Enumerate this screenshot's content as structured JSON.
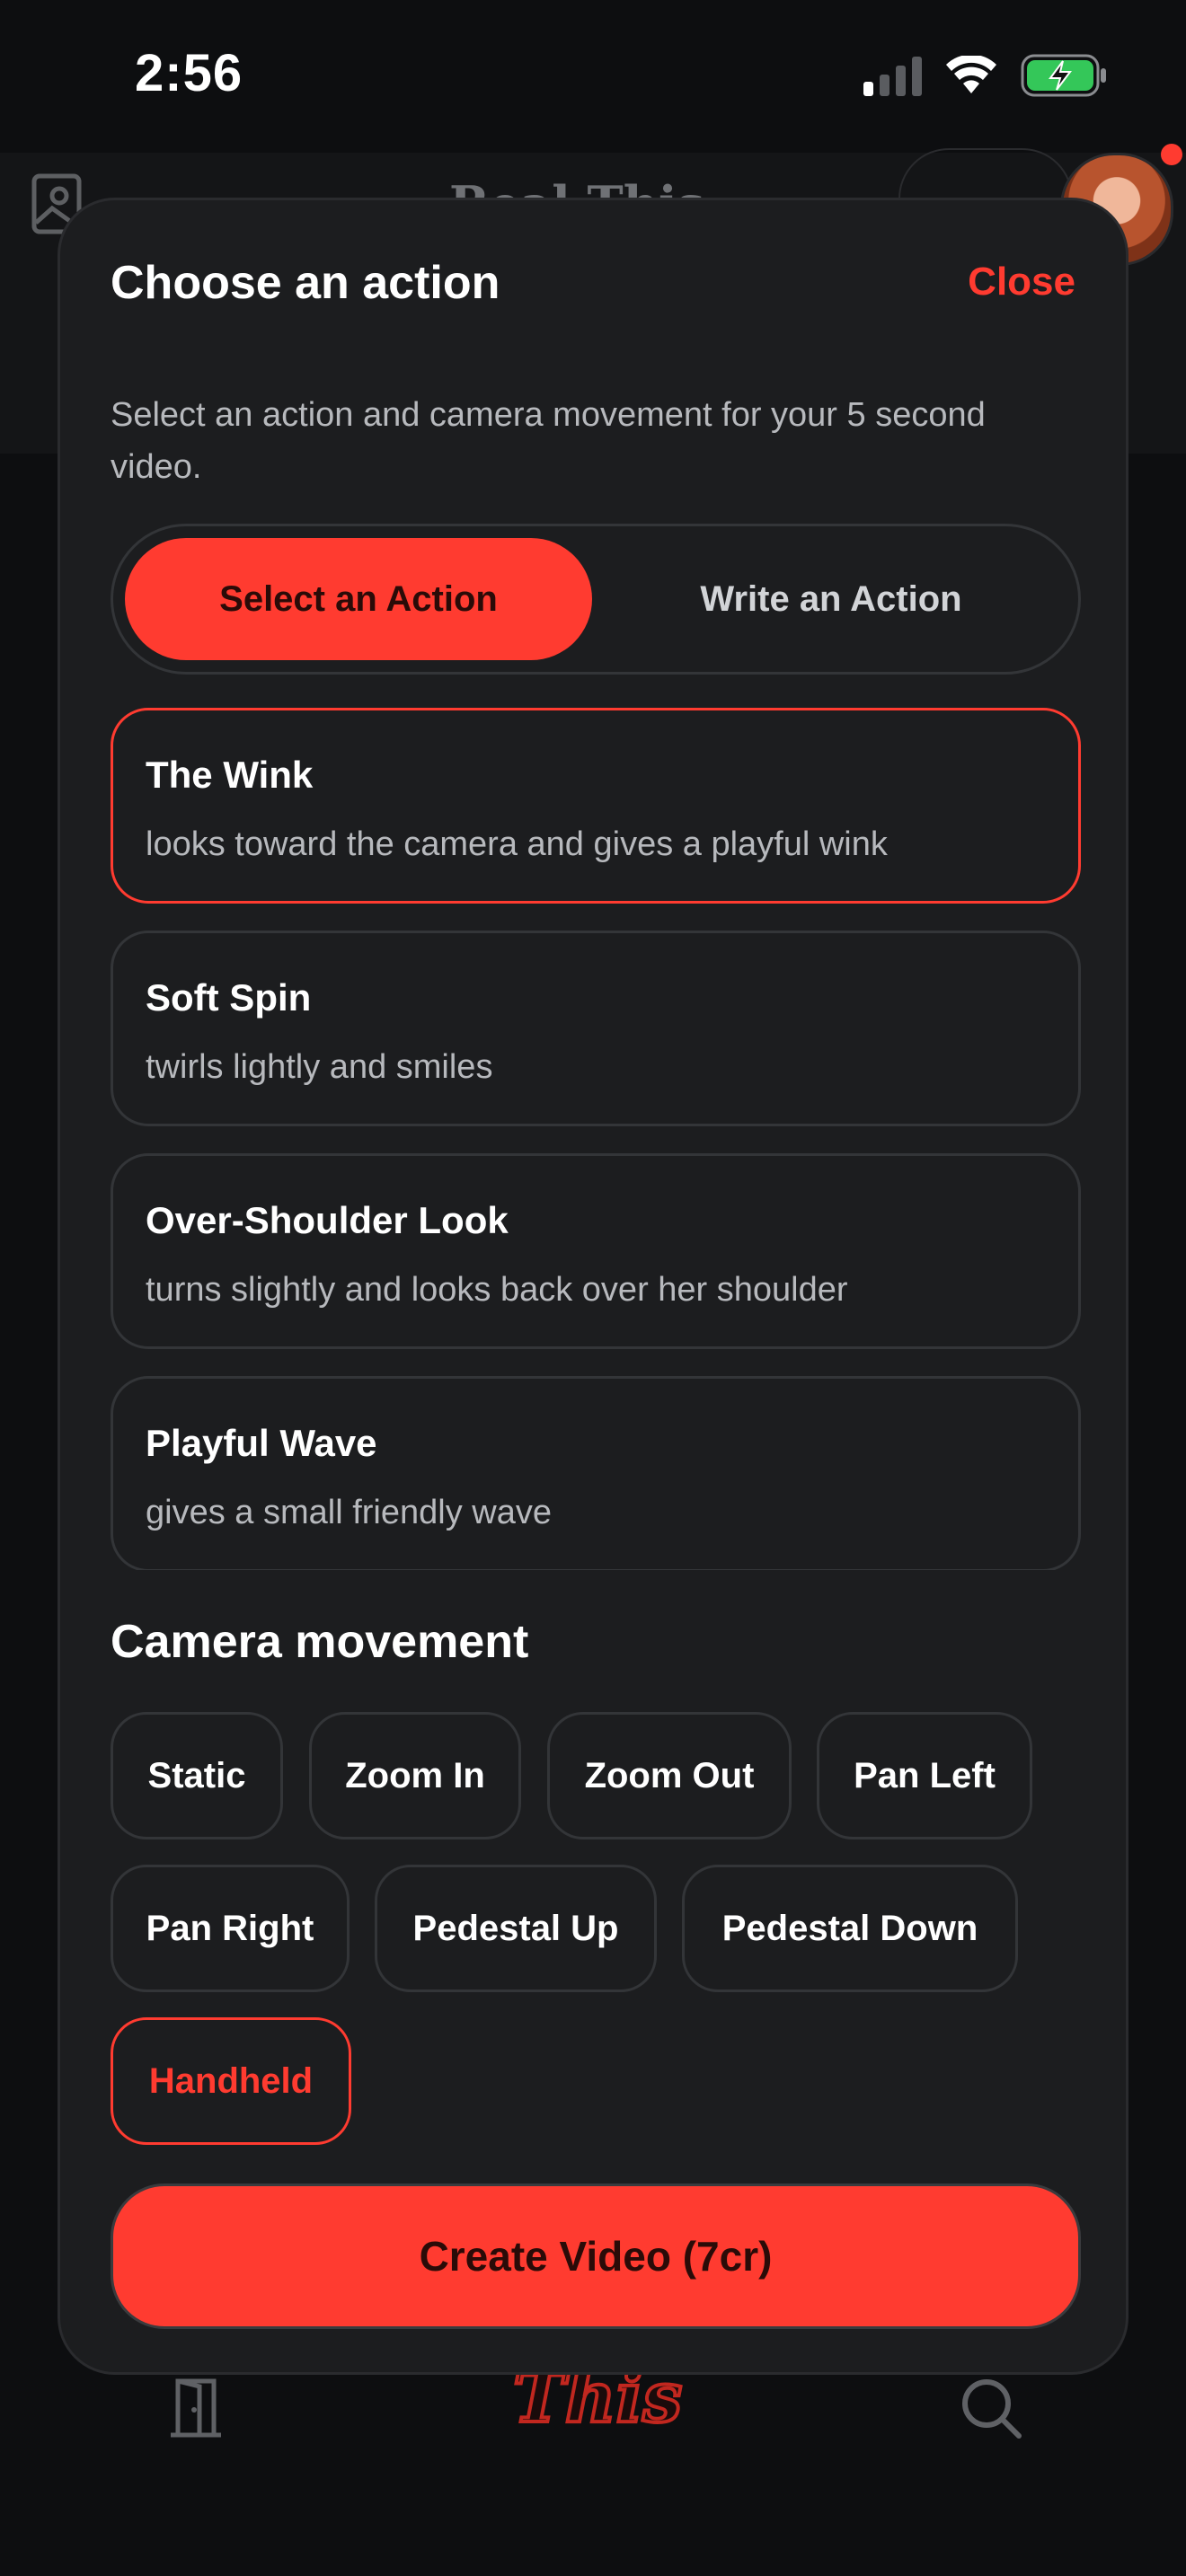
{
  "status_bar": {
    "time": "2:56",
    "signal_icon": "cellular-signal-icon",
    "wifi_icon": "wifi-icon",
    "battery_icon": "battery-charging-icon",
    "battery_color": "#34c759"
  },
  "background": {
    "title": "Real This"
  },
  "sheet": {
    "title": "Choose an action",
    "close_label": "Close",
    "description": "Select an action and camera movement for your 5 second video.",
    "tabs": {
      "select_label": "Select an Action",
      "write_label": "Write an Action",
      "active": "select"
    },
    "actions": [
      {
        "title": "The Wink",
        "description": "looks toward the camera and gives a playful wink",
        "selected": true
      },
      {
        "title": "Soft Spin",
        "description": "twirls lightly and smiles",
        "selected": false
      },
      {
        "title": "Over-Shoulder Look",
        "description": "turns slightly and looks back over her shoulder",
        "selected": false
      },
      {
        "title": "Playful Wave",
        "description": "gives a small friendly wave",
        "selected": false
      }
    ],
    "camera_heading": "Camera movement",
    "camera_movements": [
      {
        "label": "Static",
        "selected": false
      },
      {
        "label": "Zoom In",
        "selected": false
      },
      {
        "label": "Zoom Out",
        "selected": false
      },
      {
        "label": "Pan Left",
        "selected": false
      },
      {
        "label": "Pan Right",
        "selected": false
      },
      {
        "label": "Pedestal Up",
        "selected": false
      },
      {
        "label": "Pedestal Down",
        "selected": false
      },
      {
        "label": "Handheld",
        "selected": true
      }
    ],
    "create_label": "Create Video (7cr)"
  },
  "colors": {
    "accent": "#ff3b30",
    "sheet_bg": "#1c1d1f",
    "page_bg": "#0d0e10"
  }
}
